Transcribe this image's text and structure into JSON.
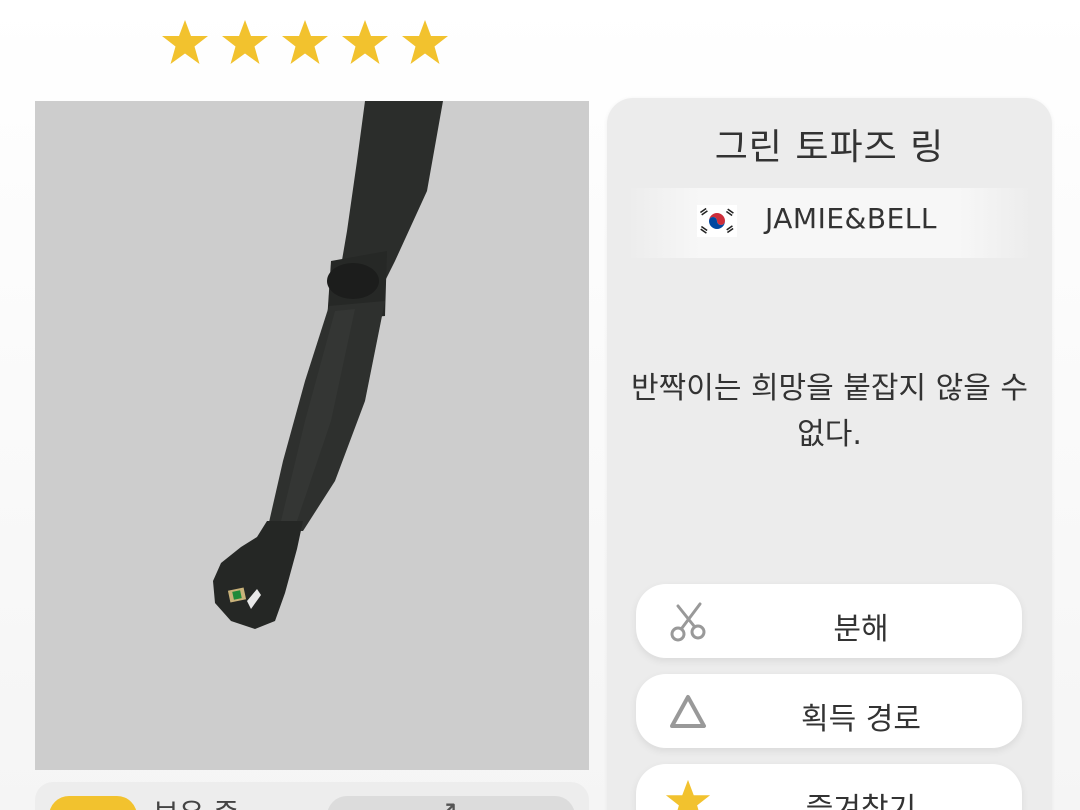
{
  "rating": {
    "star_count": 5,
    "star_color": "#f2c22e",
    "icon": "star-icon"
  },
  "preview": {
    "background_color": "#cdcdcd",
    "subject": "arm-with-ring"
  },
  "item": {
    "name": "그린 토파즈 링",
    "brand": {
      "name": "JAMIE&BELL",
      "flag_icon": "south-korea-flag-icon"
    },
    "description": "반짝이는 희망을 붙잡지 않을 수 없다."
  },
  "actions": {
    "disassemble": {
      "label": "분해",
      "icon": "scissors-icon"
    },
    "acquire_path": {
      "label": "획득 경로",
      "icon": "triangle-icon"
    },
    "favorite": {
      "label": "즐겨찾기",
      "icon": "star-icon"
    }
  },
  "owned": {
    "label": "보유 중"
  },
  "colors": {
    "accent_yellow": "#f2c22e",
    "card_background": "#ececec",
    "text": "#333333"
  }
}
